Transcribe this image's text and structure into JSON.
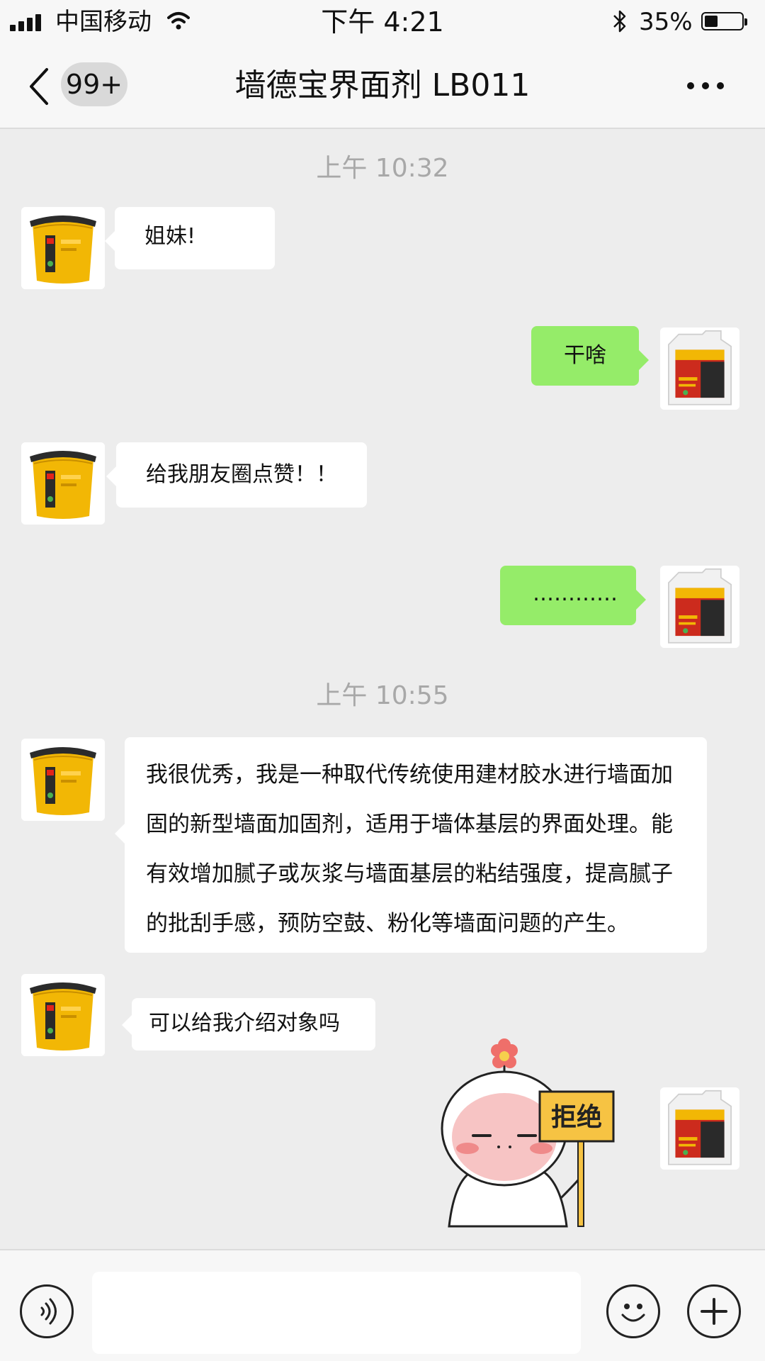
{
  "status_bar": {
    "carrier": "中国移动",
    "time": "下午 4:21",
    "battery_percent": "35%",
    "battery_level": 0.35,
    "signal_icon": "signal-bars-icon",
    "wifi_icon": "wifi-icon",
    "bluetooth_icon": "bluetooth-icon"
  },
  "header": {
    "back_icon": "chevron-left-icon",
    "unread_badge": "99+",
    "title": "墙德宝界面剂 LB011",
    "more_icon": "more-dots-icon"
  },
  "messages": [
    {
      "type": "timestamp",
      "text": "上午 10:32"
    },
    {
      "type": "incoming",
      "text": "姐妹!"
    },
    {
      "type": "outgoing",
      "text": "干啥"
    },
    {
      "type": "incoming",
      "text": "给我朋友圈点赞！！"
    },
    {
      "type": "outgoing",
      "text": "…………"
    },
    {
      "type": "timestamp",
      "text": "上午 10:55"
    },
    {
      "type": "incoming",
      "lines": [
        "我很优秀，我是一种取代传统使用建材胶水进行墙面加",
        "固的新型墙面加固剂，适用于墙体基层的界面处理。能",
        "有效增加腻子或灰浆与墙面基层的粘结强度，提高腻子",
        "的批刮手感，预防空鼓、粉化等墙面问题的产生。"
      ]
    },
    {
      "type": "incoming",
      "text": "可以给我介绍对象吗"
    },
    {
      "type": "outgoing-sticker",
      "sticker_text": "拒绝"
    }
  ],
  "input_bar": {
    "voice_icon": "voice-icon",
    "text_value": "",
    "emoji_icon": "emoji-icon",
    "plus_icon": "plus-icon"
  },
  "colors": {
    "background": "#ededed",
    "outgoing_bubble": "#95ec69",
    "incoming_bubble": "#ffffff",
    "timestamp": "#a8a8a8",
    "bars": "#f7f7f7"
  }
}
